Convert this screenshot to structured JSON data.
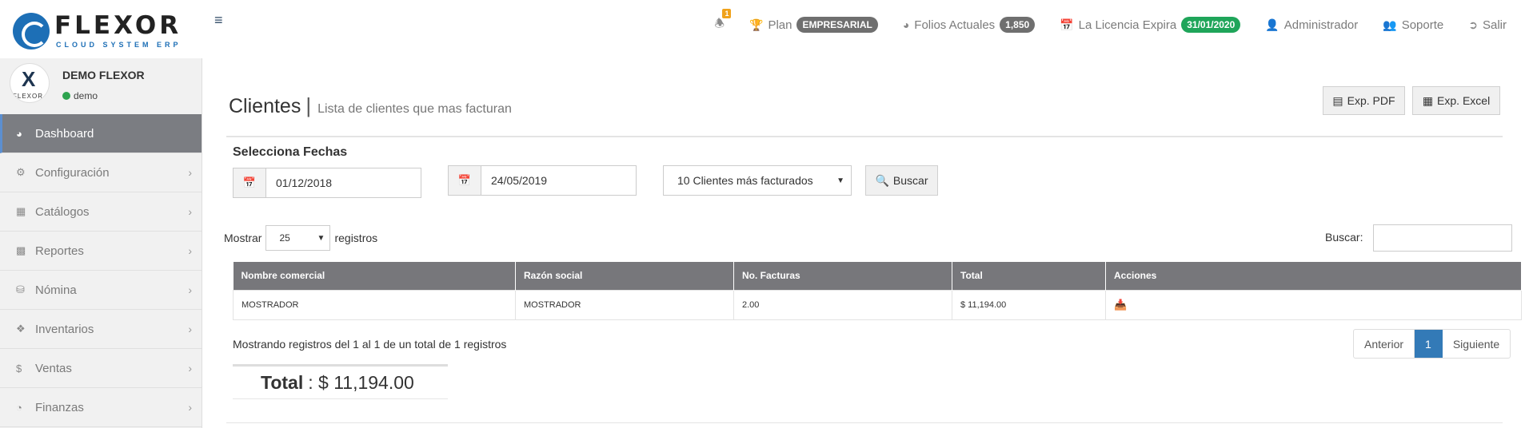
{
  "brand": {
    "name": "FLEXOR",
    "tagline": "CLOUD SYSTEM ERP"
  },
  "header": {
    "notifications_count": "1",
    "plan_label": "Plan",
    "plan_value": "EMPRESARIAL",
    "folios_label": "Folios Actuales",
    "folios_value": "1,850",
    "license_label": "La Licencia Expira",
    "license_value": "31/01/2020",
    "user_label": "Administrador",
    "support_label": "Soporte",
    "logout_label": "Salir"
  },
  "profile": {
    "name": "DEMO FLEXOR",
    "status": "demo",
    "avatar_text": "FLEXOR"
  },
  "sidebar": {
    "items": [
      {
        "label": "Dashboard",
        "icon": "dashboard-icon"
      },
      {
        "label": "Configuración",
        "icon": "gears-icon"
      },
      {
        "label": "Catálogos",
        "icon": "grid-icon"
      },
      {
        "label": "Reportes",
        "icon": "bar-chart-icon"
      },
      {
        "label": "Nómina",
        "icon": "database-icon"
      },
      {
        "label": "Inventarios",
        "icon": "dropbox-icon"
      },
      {
        "label": "Ventas",
        "icon": "dollar-icon"
      },
      {
        "label": "Finanzas",
        "icon": "pie-chart-icon"
      }
    ]
  },
  "page": {
    "title": "Clientes",
    "subtitle": "Lista de clientes que mas facturan",
    "export_pdf": "Exp. PDF",
    "export_excel": "Exp. Excel",
    "date_section_label": "Selecciona Fechas",
    "date_from": "01/12/2018",
    "date_to": "24/05/2019",
    "top_select": "10 Clientes más facturados",
    "search_button": "Buscar"
  },
  "table": {
    "show_label": "Mostrar",
    "show_value": "25",
    "records_label": "registros",
    "search_label": "Buscar:",
    "columns": [
      "Nombre comercial",
      "Razón social",
      "No. Facturas",
      "Total",
      "Acciones"
    ],
    "rows": [
      {
        "nombre": "MOSTRADOR",
        "razon": "MOSTRADOR",
        "facturas": "2.00",
        "total": "$ 11,194.00"
      }
    ],
    "info": "Mostrando registros del 1 al 1 de un total de 1 registros",
    "pager": {
      "prev": "Anterior",
      "page": "1",
      "next": "Siguiente"
    }
  },
  "summary": {
    "label": "Total",
    "value": ": $ 11,194.00"
  }
}
